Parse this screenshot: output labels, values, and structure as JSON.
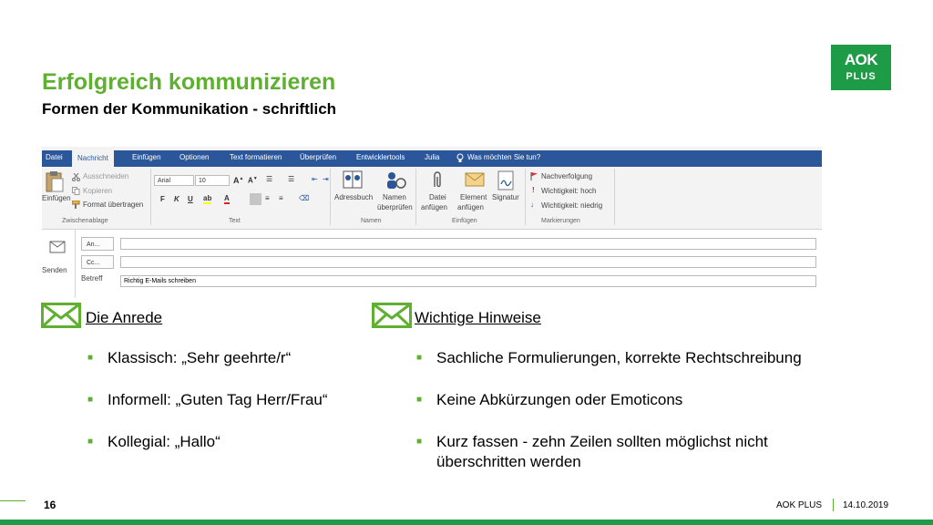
{
  "slide": {
    "title": "Erfolgreich kommunizieren",
    "subtitle": "Formen der Kommunikation - schriftlich",
    "logo": {
      "line1": "AOK",
      "line2": "PLUS"
    },
    "page_number": "16",
    "footer_org": "AOK PLUS",
    "footer_date": "14.10.2019"
  },
  "outlook": {
    "tabs": [
      "Datei",
      "Nachricht",
      "Einfügen",
      "Optionen",
      "Text formatieren",
      "Überprüfen",
      "Entwicklertools",
      "Julia",
      "Was möchten Sie tun?"
    ],
    "clipboard": {
      "paste": "Einfügen",
      "cut": "Ausschneiden",
      "copy": "Kopieren",
      "format_painter": "Format übertragen",
      "group": "Zwischenablage"
    },
    "text": {
      "font": "Arial",
      "size": "10",
      "bold": "F",
      "italic": "K",
      "underline": "U",
      "group": "Text"
    },
    "names": {
      "address_book": "Adressbuch",
      "check_names_1": "Namen",
      "check_names_2": "überprüfen",
      "group": "Namen"
    },
    "include": {
      "attach_1": "Datei",
      "attach_2": "anfügen",
      "item_1": "Element",
      "item_2": "anfügen",
      "signature": "Signatur",
      "group": "Einfügen"
    },
    "tags": {
      "followup": "Nachverfolgung",
      "high": "Wichtigkeit: hoch",
      "low": "Wichtigkeit: niedrig",
      "group": "Markierungen"
    },
    "send": "Senden",
    "to": "An...",
    "cc": "Cc...",
    "subject_label": "Betreff",
    "subject_value": "Richtig E-Mails schreiben"
  },
  "left_section": {
    "heading": "Die Anrede",
    "bullets": [
      "Klassisch: „Sehr geehrte/r“",
      "Informell: „Guten Tag Herr/Frau“",
      "Kollegial: „Hallo“"
    ]
  },
  "right_section": {
    "heading": "Wichtige Hinweise",
    "bullets": [
      "Sachliche Formulierungen, korrekte Rechtschreibung",
      "Keine Abkürzungen oder Emoticons",
      "Kurz fassen - zehn Zeilen sollten möglichst nicht überschritten werden"
    ]
  },
  "colors": {
    "accent_green": "#5fb030",
    "brand_green": "#1e9b46",
    "outlook_blue": "#2b579a"
  },
  "icons": [
    "envelope-icon",
    "paste-icon",
    "scissors-icon",
    "copy-icon",
    "format-painter-icon",
    "address-book-icon",
    "check-names-icon",
    "paperclip-icon",
    "attach-item-icon",
    "signature-icon",
    "flag-icon",
    "high-importance-icon",
    "low-importance-icon",
    "lightbulb-icon",
    "send-icon"
  ]
}
